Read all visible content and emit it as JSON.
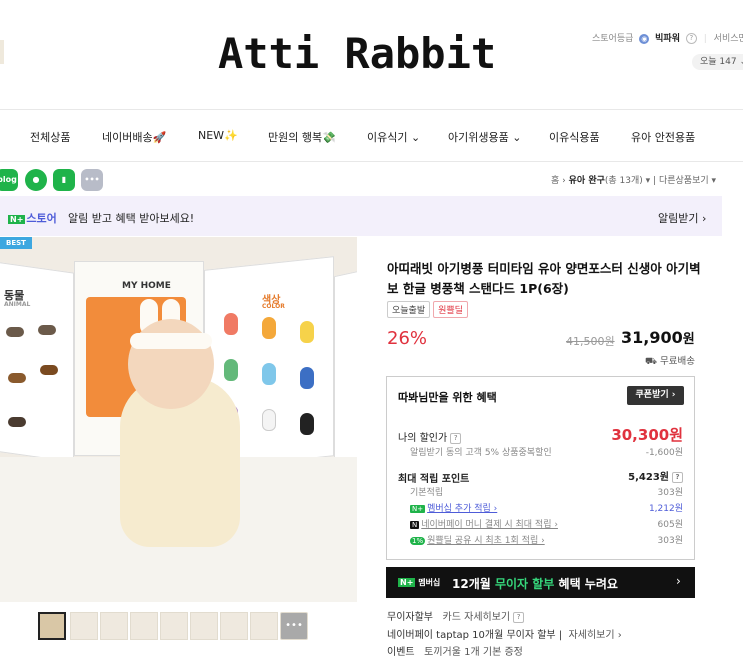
{
  "header": {
    "logo": "Atti Rabbit",
    "store_grade_label": "스토어등급",
    "store_grade": "빅파워",
    "service_label": "서비스만족",
    "today_visits": "오늘 147"
  },
  "nav": {
    "items": [
      "전체상품",
      "네이버배송🚀",
      "NEW✨",
      "만원의 행복💸",
      "이유식기 ⌄",
      "아기위생용품 ⌄",
      "이유식용품",
      "유아 안전용품"
    ]
  },
  "share": {
    "icons": [
      "blog",
      "talk",
      "keep",
      "more"
    ]
  },
  "breadcrumb": {
    "home": "홈",
    "sep": "›",
    "category": "유아 완구",
    "count": "(총 13개)",
    "other": "다른상품보기"
  },
  "banner": {
    "badge_n": "N+",
    "badge_store": "스토어",
    "text": "알림 받고 혜택 받아보세요!",
    "right": "알림받기 ›"
  },
  "image": {
    "best": "BEST",
    "panel_animal": "동물",
    "panel_animal_en": "ANIMAL",
    "panel_home": "MY HOME",
    "panel_color": "색상",
    "panel_color_en": "COLOR"
  },
  "product": {
    "title": "아띠래빗 아기병풍 터미타임 유아 양면포스터 신생아 아기벽보 한글 병풍책 스탠다드 1P(6장)",
    "tag_today": "오늘출발",
    "tag_original": "원쁠딜",
    "discount": "26%",
    "original_price": "41,500원",
    "price": "31,900",
    "won": "원",
    "shipping": "무료배송"
  },
  "benefit": {
    "title": "따봐님만을 위한 혜택",
    "coupon_button": "쿠폰받기 ›",
    "my_price_label": "나의 할인가",
    "my_price": "30,300원",
    "alert_note": "알림받기 동의 고객 5% 상품중복할인",
    "alert_amount": "-1,600원",
    "points_label": "최대 적립 포인트",
    "points": "5,423원",
    "basic_label": "기본적립",
    "basic": "303원",
    "membership_label": "멤버십 추가 적립 ›",
    "membership": "1,212원",
    "npay_label": "네이버페이 머니 결제 시 최대 적립 ›",
    "npay": "605원",
    "onepl_label": "원쁠딜 공유 시 최초 1회 적립 ›",
    "onepl": "303원"
  },
  "member": {
    "badge_n": "N+",
    "badge_text": "멤버십",
    "text_a": "12개월 ",
    "text_hl": "무이자 할부",
    "text_b": " 혜택 누려요",
    "arrow": "›"
  },
  "extras": {
    "row1_a": "무이자할부",
    "row1_b": "카드 자세히보기",
    "row2_a": "네이버페이 taptap 10개월 무이자 할부",
    "row2_b": "자세히보기 ›",
    "row3_a": "이벤트",
    "row3_b": "토끼거울 1개 기본 증정"
  }
}
